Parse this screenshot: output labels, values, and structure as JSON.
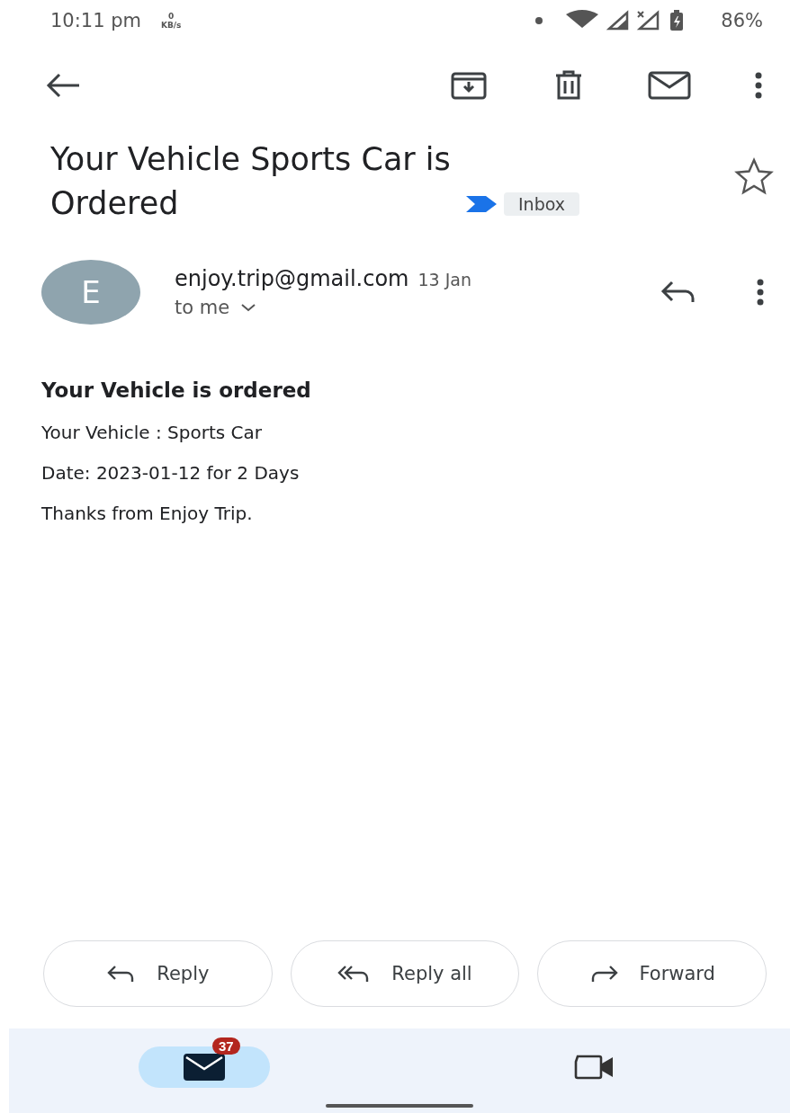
{
  "status_bar": {
    "time": "10:11 pm",
    "speed_value": "0",
    "speed_unit": "KB/s",
    "battery": "86%"
  },
  "subject": {
    "title": "Your Vehicle Sports Car is Ordered",
    "label": "Inbox",
    "starred": false
  },
  "message": {
    "avatar_letter": "E",
    "sender": "enjoy.trip@gmail.com",
    "date": "13 Jan",
    "recipient": "to me"
  },
  "body": {
    "heading": "Your Vehicle is ordered",
    "lines": [
      "Your Vehicle : Sports Car",
      "Date: 2023-01-12 for 2 Days",
      "Thanks from Enjoy Trip."
    ]
  },
  "actions": [
    {
      "kind": "reply",
      "label": "Reply"
    },
    {
      "kind": "reply_all",
      "label": "Reply all"
    },
    {
      "kind": "forward",
      "label": "Forward"
    }
  ],
  "bottom_nav": [
    {
      "kind": "mail",
      "selected": true,
      "badge": "37"
    },
    {
      "kind": "meet",
      "selected": false
    }
  ]
}
